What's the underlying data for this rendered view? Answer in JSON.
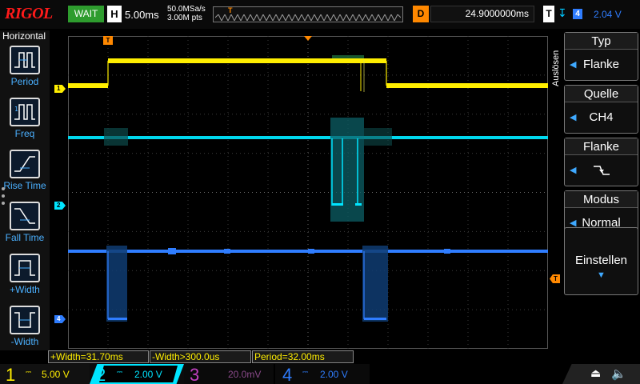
{
  "header": {
    "brand": "RIGOL",
    "run_status": "WAIT",
    "horizontal_label": "H",
    "timebase": "5.00ms",
    "sample_rate": "50.0MSa/s",
    "memory_depth": "3.00M pts",
    "trigger_marker": "T",
    "delay_label": "D",
    "delay_value": "24.9000000ms",
    "trigger_label": "T",
    "trigger_source_num": "4",
    "trigger_level": "2.04 V"
  },
  "left_menu": {
    "title": "Horizontal",
    "items": [
      {
        "label": "Period",
        "icon": "period-icon"
      },
      {
        "label": "Freq",
        "icon": "freq-icon"
      },
      {
        "label": "Rise Time",
        "icon": "rise-time-icon"
      },
      {
        "label": "Fall Time",
        "icon": "fall-time-icon"
      },
      {
        "label": "+Width",
        "icon": "pos-width-icon"
      },
      {
        "label": "-Width",
        "icon": "neg-width-icon"
      }
    ]
  },
  "screen": {
    "ch1_marker": "1",
    "ch2_marker": "2",
    "ch4_marker": "4",
    "trig_pos_marker": "T",
    "trig_level_marker": "T"
  },
  "measurements": {
    "pos_width": "+Width=31.70ms",
    "neg_width": "-Width>300.0us",
    "period": "Period=32.00ms"
  },
  "right_menu": {
    "side_title": "Auslösen",
    "buttons": [
      {
        "head": "Typ",
        "value": "Flanke"
      },
      {
        "head": "Quelle",
        "value": "CH4"
      },
      {
        "head": "Flanke",
        "value": ""
      },
      {
        "head": "Modus",
        "value": "Normal"
      }
    ],
    "settings_label": "Einstellen"
  },
  "channels": [
    {
      "num": "1",
      "scale": "5.00 V",
      "color": "#ffee00"
    },
    {
      "num": "2",
      "scale": "2.00 V",
      "color": "#00e5ff"
    },
    {
      "num": "3",
      "scale": "20.0mV",
      "color": "#c040c0"
    },
    {
      "num": "4",
      "scale": "2.00 V",
      "color": "#2f7dff"
    }
  ],
  "colors": {
    "ch1": "#ffee00",
    "ch2": "#00e5ff",
    "ch3": "#c040c0",
    "ch4": "#2f7dff",
    "trigger": "#ff8800",
    "run_status_bg": "#2e9c2e",
    "brand": "#ff1a1a"
  }
}
